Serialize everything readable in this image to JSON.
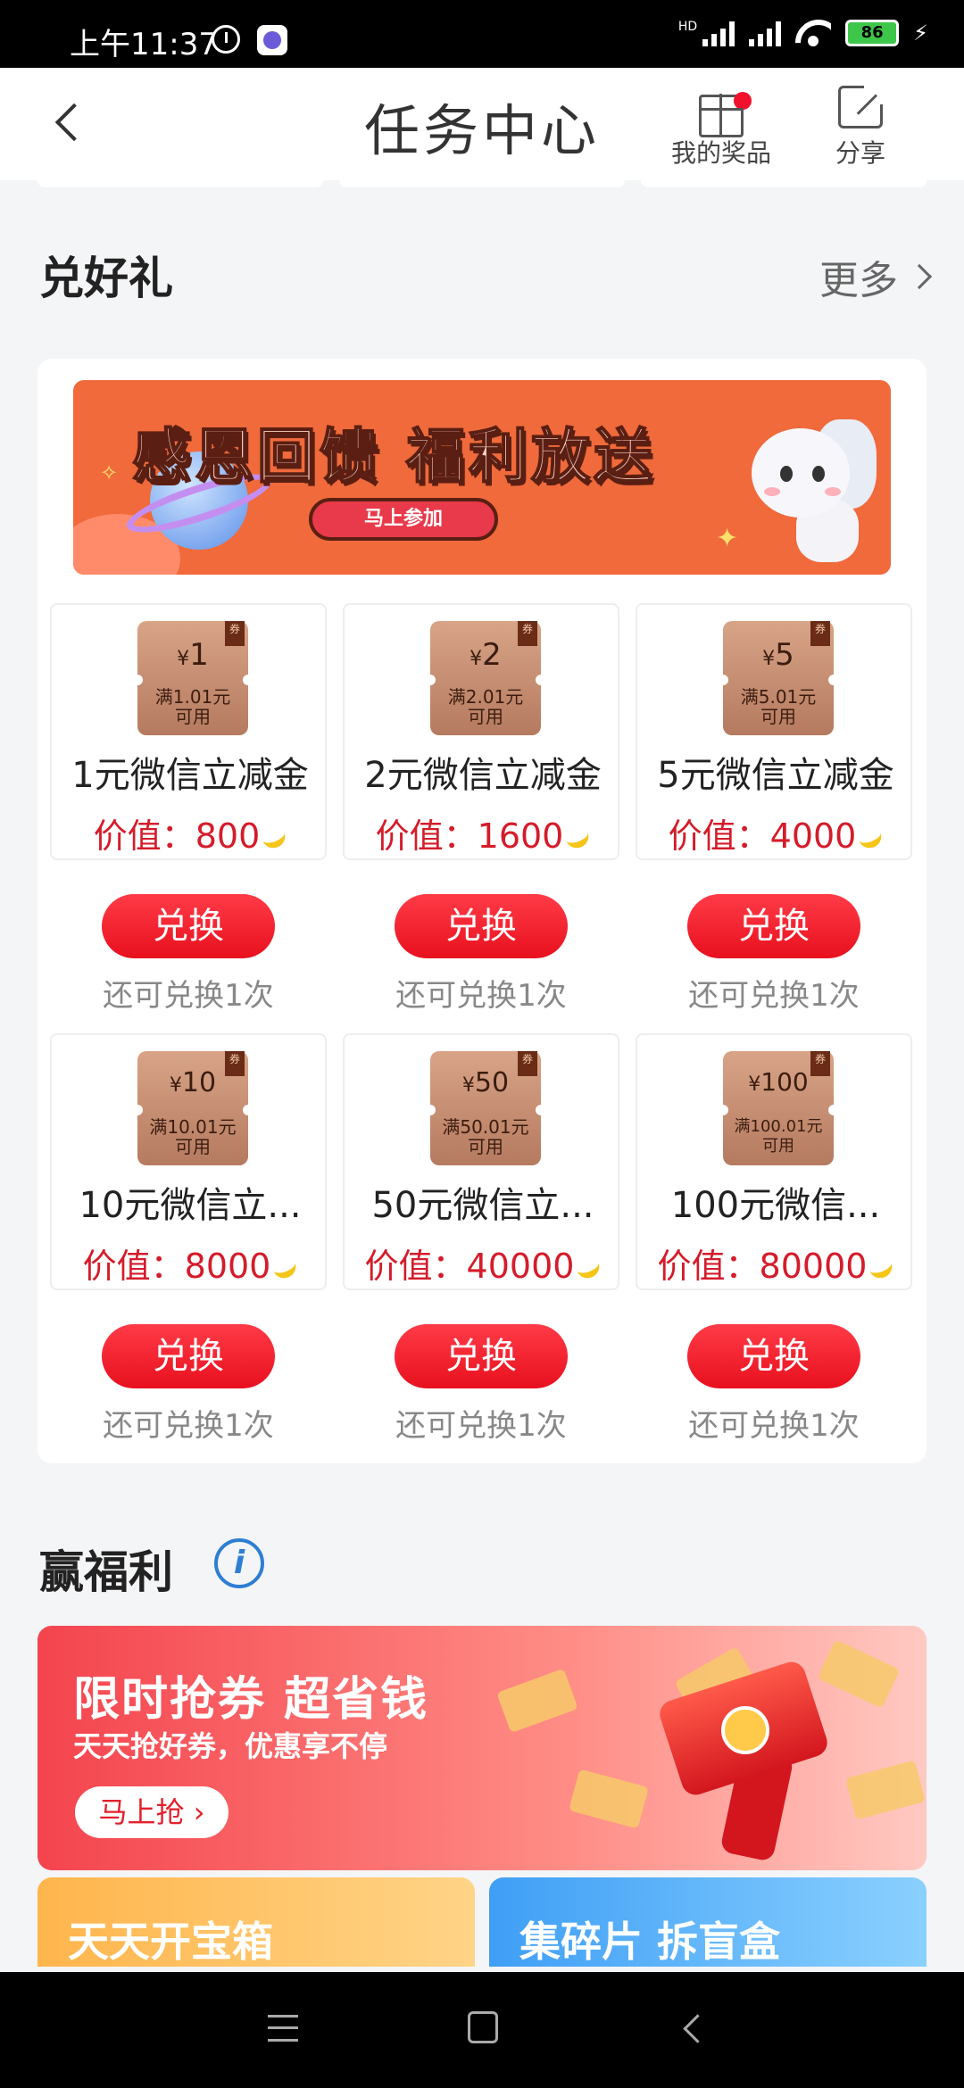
{
  "status_bar": {
    "time": "上午11:37",
    "battery": "86",
    "network": "HD"
  },
  "header": {
    "title": "任务中心",
    "prizes_label": "我的奖品",
    "share_label": "分享"
  },
  "redeem_section": {
    "title": "兑好礼",
    "more_label": "更多",
    "banner": {
      "title": "感恩回馈 福利放送",
      "cta": "马上参加"
    },
    "items": [
      {
        "amount": "1",
        "condition_line1": "满1.01元",
        "condition_line2": "可用",
        "name": "1元微信立减金",
        "price": "价值：800",
        "button": "兑换",
        "remaining": "还可兑换1次"
      },
      {
        "amount": "2",
        "condition_line1": "满2.01元",
        "condition_line2": "可用",
        "name": "2元微信立减金",
        "price": "价值：1600",
        "button": "兑换",
        "remaining": "还可兑换1次"
      },
      {
        "amount": "5",
        "condition_line1": "满5.01元",
        "condition_line2": "可用",
        "name": "5元微信立减金",
        "price": "价值：4000",
        "button": "兑换",
        "remaining": "还可兑换1次"
      },
      {
        "amount": "10",
        "condition_line1": "满10.01元",
        "condition_line2": "可用",
        "name": "10元微信立...",
        "price": "价值：8000",
        "button": "兑换",
        "remaining": "还可兑换1次"
      },
      {
        "amount": "50",
        "condition_line1": "满50.01元",
        "condition_line2": "可用",
        "name": "50元微信立...",
        "price": "价值：40000",
        "button": "兑换",
        "remaining": "还可兑换1次"
      },
      {
        "amount": "100",
        "condition_line1": "满100.01元",
        "condition_line2": "可用",
        "name": "100元微信...",
        "price": "价值：80000",
        "button": "兑换",
        "remaining": "还可兑换1次"
      }
    ],
    "currency_symbol": "¥",
    "coupon_tag": "券"
  },
  "welfare_section": {
    "title": "赢福利",
    "info_icon": "i",
    "promo": {
      "title": "限时抢券 超省钱",
      "subtitle": "天天抢好券，优惠享不停",
      "button": "马上抢"
    },
    "tiles": [
      {
        "label": "天天开宝箱"
      },
      {
        "label": "集碎片 拆盲盒"
      }
    ]
  },
  "colors": {
    "accent_red": "#e8101e",
    "price_red": "#d41c2a",
    "banner_orange": "#f06a3b"
  }
}
